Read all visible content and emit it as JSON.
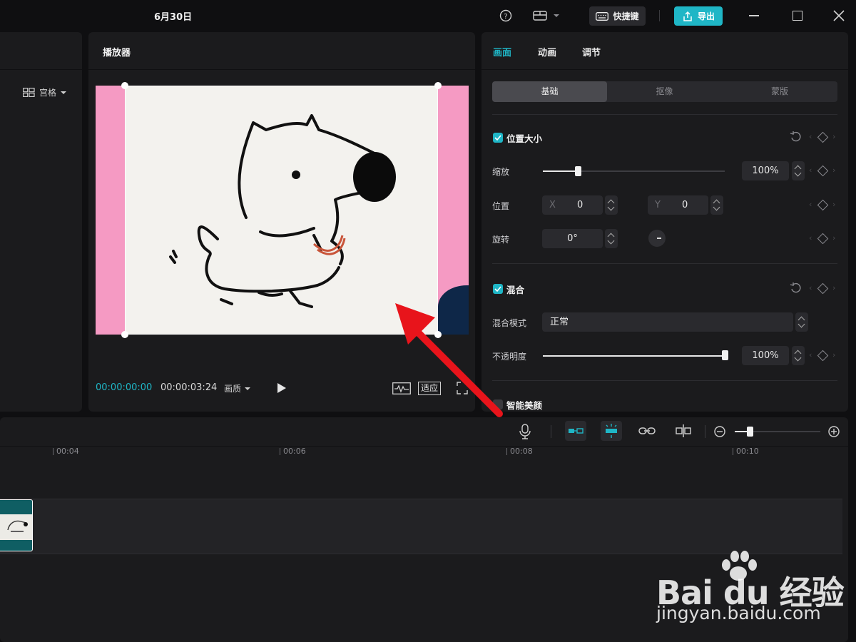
{
  "topbar": {
    "title": "6月30日",
    "shortcut_label": "快捷键",
    "export_label": "导出"
  },
  "player": {
    "title": "播放器",
    "current_time": "00:00:00:00",
    "total_time": "00:00:03:24",
    "quality_label": "画质",
    "fit_label": "适应"
  },
  "left_panel": {
    "grid_label": "宫格"
  },
  "inspector": {
    "tabs": [
      "画面",
      "动画",
      "调节"
    ],
    "subtabs": [
      "基础",
      "抠像",
      "蒙版"
    ],
    "position_size": {
      "title": "位置大小",
      "scale_label": "缩放",
      "scale_value": "100%",
      "scale_level": 0.2,
      "position_label": "位置",
      "x_label": "X",
      "x_value": "0",
      "y_label": "Y",
      "y_value": "0",
      "rotate_label": "旋转",
      "rotate_value": "0°"
    },
    "blend": {
      "title": "混合",
      "mode_label": "混合模式",
      "mode_value": "正常",
      "opacity_label": "不透明度",
      "opacity_value": "100%",
      "opacity_level": 1.0
    },
    "beauty": {
      "title": "智能美颜"
    }
  },
  "timeline": {
    "ruler": [
      "00:04",
      "00:06",
      "00:08",
      "00:10"
    ]
  },
  "watermark": {
    "brand": "Bai du 经验",
    "url": "jingyan.baidu.com"
  },
  "colors": {
    "accent": "#1fb6c6",
    "arrow": "#e8141b",
    "pink_bg": "#f59ac3"
  }
}
